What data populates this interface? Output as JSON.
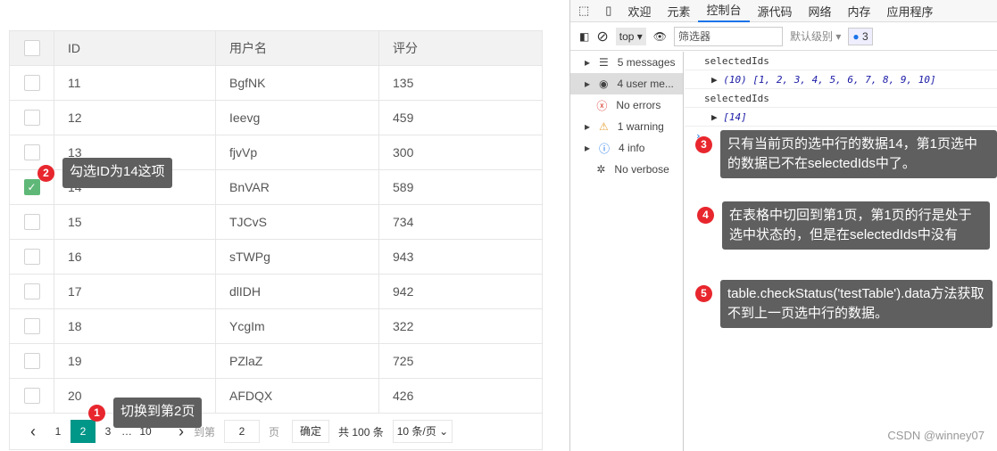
{
  "table": {
    "headers": [
      "ID",
      "用户名",
      "评分"
    ],
    "rows": [
      {
        "id": "11",
        "name": "BgfNK",
        "score": "135",
        "checked": false
      },
      {
        "id": "12",
        "name": "Ieevg",
        "score": "459",
        "checked": false
      },
      {
        "id": "13",
        "name": "fjvVp",
        "score": "300",
        "checked": false
      },
      {
        "id": "14",
        "name": "BnVAR",
        "score": "589",
        "checked": true
      },
      {
        "id": "15",
        "name": "TJCvS",
        "score": "734",
        "checked": false
      },
      {
        "id": "16",
        "name": "sTWPg",
        "score": "943",
        "checked": false
      },
      {
        "id": "17",
        "name": "dlIDH",
        "score": "942",
        "checked": false
      },
      {
        "id": "18",
        "name": "YcgIm",
        "score": "322",
        "checked": false
      },
      {
        "id": "19",
        "name": "PZlaZ",
        "score": "725",
        "checked": false
      },
      {
        "id": "20",
        "name": "AFDQX",
        "score": "426",
        "checked": false
      }
    ]
  },
  "pager": {
    "prev": "‹",
    "pages": [
      "1",
      "2",
      "3",
      "…",
      "10"
    ],
    "current": "2",
    "next": "›",
    "goto": "到第",
    "goto_value": "2",
    "page_unit": "页",
    "confirm": "确定",
    "total": "共 100 条",
    "per_page": "10 条/页"
  },
  "devtools": {
    "tabs": [
      "欢迎",
      "元素",
      "控制台",
      "源代码",
      "网络",
      "内存",
      "应用程序"
    ],
    "active_tab": "控制台",
    "toolbar": {
      "context": "top",
      "filter_placeholder": "筛选器",
      "level": "默认级别",
      "issues": "3"
    },
    "sidebar": [
      "5 messages",
      "4 user me...",
      "No errors",
      "1 warning",
      "4 info",
      "No verbose"
    ],
    "console": [
      "selectedIds",
      "(10) [1, 2, 3, 4, 5, 6, 7, 8, 9, 10]",
      "selectedIds",
      "[14]"
    ]
  },
  "annotations": [
    {
      "num": "1",
      "text": "切换到第2页"
    },
    {
      "num": "2",
      "text": "勾选ID为14这项"
    },
    {
      "num": "3",
      "text": "只有当前页的选中行的数据14，第1页选中的数据已不在selectedIds中了。"
    },
    {
      "num": "4",
      "text": "在表格中切回到第1页，第1页的行是处于选中状态的，但是在selectedIds中没有"
    },
    {
      "num": "5",
      "text": "table.checkStatus('testTable').data方法获取不到上一页选中行的数据。"
    }
  ],
  "watermark": "CSDN @winney07"
}
